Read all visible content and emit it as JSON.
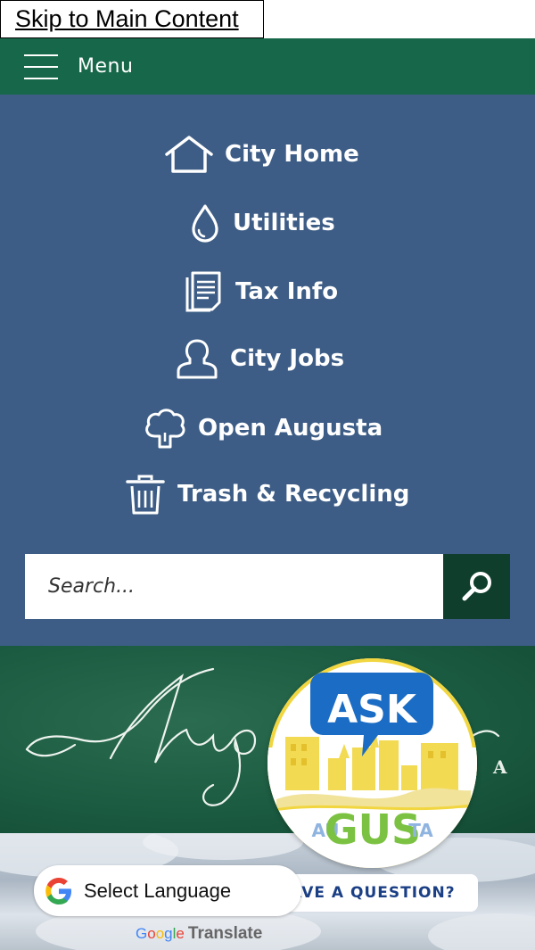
{
  "skip_link": "Skip to Main Content",
  "menu": {
    "label": "Menu"
  },
  "nav": {
    "items": [
      {
        "label": "City Home",
        "icon": "house-icon"
      },
      {
        "label": "Utilities",
        "icon": "water-drop-icon"
      },
      {
        "label": "Tax Info",
        "icon": "document-icon"
      },
      {
        "label": "City Jobs",
        "icon": "person-icon"
      },
      {
        "label": "Open Augusta",
        "icon": "tree-icon"
      },
      {
        "label": "Trash & Recycling",
        "icon": "trash-icon"
      }
    ]
  },
  "search": {
    "placeholder": "Search...",
    "button_icon": "search-icon"
  },
  "banner": {
    "letter": "A"
  },
  "ask_gus": {
    "ask": "ASK",
    "au": "AU",
    "gus": "GUS",
    "ta": "TA",
    "question": "HAVE A QUESTION?"
  },
  "translate": {
    "select_label": "Select Language",
    "powered_by": "Translate"
  },
  "colors": {
    "menu_bar": "#17684a",
    "nav_panel": "#3d5d86",
    "search_button": "#0f3f2c",
    "gus_blue": "#1b6cc4",
    "gus_green": "#7cc242",
    "gus_yellow": "#f1d640"
  }
}
